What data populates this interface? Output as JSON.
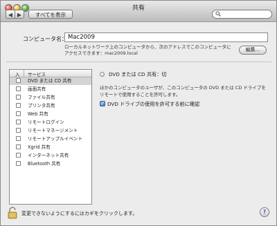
{
  "window": {
    "title": "共有"
  },
  "toolbar": {
    "back": "◀",
    "forward": "▶",
    "show_all": "すべてを表示",
    "search_placeholder": "",
    "search_icon": "search-icon"
  },
  "computer_name": {
    "label": "コンピュータ名：",
    "value": "Mac2009",
    "description_line1": "ローカルネットワーク上のコンピュータから、次のアドレスでこのコンピュータに",
    "description_line2": "アクセスできます：mac2009.local",
    "edit_button": "編集..."
  },
  "services": {
    "header_on": "入",
    "header_name": "サービス",
    "items": [
      {
        "label": "DVD または CD 共有",
        "checked": false,
        "selected": true
      },
      {
        "label": "画面共有",
        "checked": false,
        "selected": false
      },
      {
        "label": "ファイル共有",
        "checked": false,
        "selected": false
      },
      {
        "label": "プリンタ共有",
        "checked": false,
        "selected": false
      },
      {
        "label": "Web 共有",
        "checked": false,
        "selected": false
      },
      {
        "label": "リモートログイン",
        "checked": false,
        "selected": false
      },
      {
        "label": "リモートマネージメント",
        "checked": false,
        "selected": false
      },
      {
        "label": "リモートアップルイベント",
        "checked": false,
        "selected": false
      },
      {
        "label": "Xgrid 共有",
        "checked": false,
        "selected": false
      },
      {
        "label": "インターネット共有",
        "checked": false,
        "selected": false
      },
      {
        "label": "Bluetooth 共有",
        "checked": false,
        "selected": false
      }
    ]
  },
  "detail": {
    "status": "DVD または CD 共有：切",
    "description_line1": "ほかのコンピュータのユーザが、このコンピュータの DVD または CD ドライブを",
    "description_line2": "リモートで使用することを許可します。",
    "confirm_label": "DVD ドライブの使用を許可する前に確認",
    "confirm_checked": true
  },
  "footer": {
    "lock_text": "変更できないようにするにはカギをクリックします。",
    "help": "?"
  }
}
